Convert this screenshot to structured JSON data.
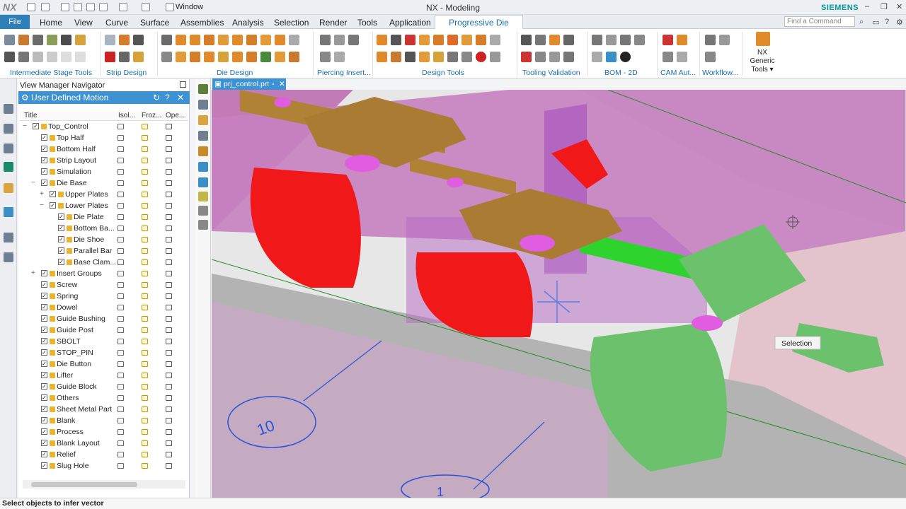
{
  "window": {
    "logo": "NX",
    "window_menu": "Window",
    "title": "NX - Modeling",
    "brand": "SIEMENS",
    "controls": [
      "–",
      "❐",
      "✕"
    ]
  },
  "menu": {
    "file": "File",
    "items": [
      "Home",
      "View",
      "Curve",
      "Surface",
      "Assemblies",
      "Analysis",
      "Selection",
      "Render",
      "Tools",
      "Application"
    ],
    "active_tab": "Progressive Die Wizard",
    "search_placeholder": "Find a Command"
  },
  "ribbon": {
    "groups": [
      "Intermediate Stage Tools",
      "Strip Design",
      "Die Design",
      "Piercing Insert...",
      "Design Tools",
      "Tooling Validation",
      "BOM - 2D",
      "CAM Aut...",
      "Workflow..."
    ],
    "nx_generic": "NX Generic Tools ▾"
  },
  "navigator": {
    "title": "View Manager Navigator",
    "panel": "User Defined Motion",
    "columns": [
      "Title",
      "Isol...",
      "Froz...",
      "Ope..."
    ],
    "rows": [
      {
        "label": "Top_Control",
        "level": 0,
        "expand": "−"
      },
      {
        "label": "Top Half",
        "level": 1,
        "expand": ""
      },
      {
        "label": "Bottom Half",
        "level": 1,
        "expand": ""
      },
      {
        "label": "Strip Layout",
        "level": 1,
        "expand": ""
      },
      {
        "label": "Simulation",
        "level": 1,
        "expand": ""
      },
      {
        "label": "Die Base",
        "level": 1,
        "expand": "−"
      },
      {
        "label": "Upper Plates",
        "level": 2,
        "expand": "+"
      },
      {
        "label": "Lower Plates",
        "level": 2,
        "expand": "−"
      },
      {
        "label": "Die Plate",
        "level": 3,
        "expand": ""
      },
      {
        "label": "Bottom Ba...",
        "level": 3,
        "expand": ""
      },
      {
        "label": "Die Shoe",
        "level": 3,
        "expand": ""
      },
      {
        "label": "Parallel Bar",
        "level": 3,
        "expand": ""
      },
      {
        "label": "Base Clam...",
        "level": 3,
        "expand": ""
      },
      {
        "label": "Insert Groups",
        "level": 1,
        "expand": "+"
      },
      {
        "label": "Screw",
        "level": 1,
        "expand": ""
      },
      {
        "label": "Spring",
        "level": 1,
        "expand": ""
      },
      {
        "label": "Dowel",
        "level": 1,
        "expand": ""
      },
      {
        "label": "Guide Bushing",
        "level": 1,
        "expand": ""
      },
      {
        "label": "Guide Post",
        "level": 1,
        "expand": ""
      },
      {
        "label": "SBOLT",
        "level": 1,
        "expand": ""
      },
      {
        "label": "STOP_PIN",
        "level": 1,
        "expand": ""
      },
      {
        "label": "Die Button",
        "level": 1,
        "expand": ""
      },
      {
        "label": "Lifter",
        "level": 1,
        "expand": ""
      },
      {
        "label": "Guide Block",
        "level": 1,
        "expand": ""
      },
      {
        "label": "Others",
        "level": 1,
        "expand": ""
      },
      {
        "label": "Sheet Metal Part",
        "level": 1,
        "expand": ""
      },
      {
        "label": "Blank",
        "level": 1,
        "expand": ""
      },
      {
        "label": "Process",
        "level": 1,
        "expand": ""
      },
      {
        "label": "Blank Layout",
        "level": 1,
        "expand": ""
      },
      {
        "label": "Relief",
        "level": 1,
        "expand": ""
      },
      {
        "label": "Slug Hole",
        "level": 1,
        "expand": ""
      }
    ]
  },
  "document_tab": "prj_control.prt",
  "viewport": {
    "tooltip": "Selection",
    "circle_labels": [
      "10",
      "1"
    ]
  },
  "status": "Select objects to infer vector"
}
